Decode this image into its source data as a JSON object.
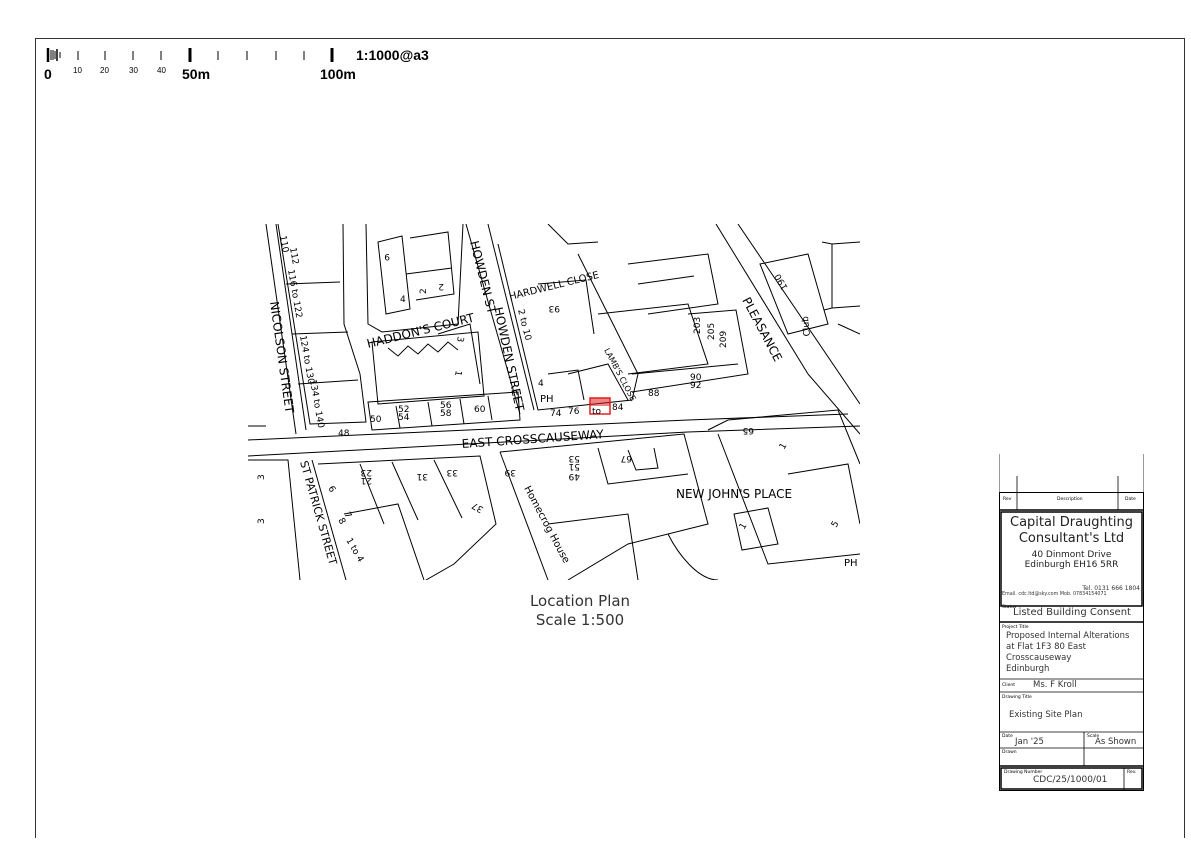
{
  "scale_bar": {
    "ticks": [
      "0",
      "10",
      "20",
      "30",
      "40",
      "50m",
      "100m"
    ],
    "ratio": "1:1000@a3"
  },
  "map": {
    "streets": {
      "nicolson": "NICOLSON STREET",
      "howden_upper": "HOWDEN ST",
      "howden_lower": "HOWDEN STREET",
      "haddons": "HADDON'S COURT",
      "east_cross": "EAST CROSSCAUSEWAY",
      "new_johns": "NEW JOHN'S PLACE",
      "st_patrick": "ST PATRICK STREET",
      "pleasance": "PLEASANCE",
      "hardwell": "HARDWELL CLOSE",
      "lambs": "LAMB'S CLOSE"
    },
    "labels": {
      "n110": "110",
      "n112": "112",
      "n116": "116 to 122",
      "n124": "124 to 130",
      "n134": "134 to 140",
      "n48": "48",
      "n50": "50",
      "n52": "52",
      "n54": "54",
      "n56": "56",
      "n58": "58",
      "n60": "60",
      "n9": "9",
      "n4a": "4",
      "n2": "2",
      "n2b": "2",
      "n3": "3",
      "n1": "1",
      "n2to10": "2 to 10",
      "n4": "4",
      "ph1": "PH",
      "n74": "74",
      "n76": "76",
      "to": "to",
      "n84": "84",
      "n88": "88",
      "n90": "90",
      "n92": "92",
      "n93": "93",
      "n203": "203",
      "n205": "205",
      "n209": "209",
      "n190": "190",
      "club": "Club",
      "n65": "65",
      "n1c": "1",
      "n23": "23",
      "n21": "21",
      "n31": "31",
      "n33": "33",
      "n37": "37",
      "n6": "6",
      "n7": "7",
      "n8": "8",
      "n1to4": "1 to 4",
      "n39": "39",
      "n53": "53",
      "n51": "51",
      "n49": "49",
      "n67": "67",
      "homecrog": "Homecrog House",
      "ph2": "PH",
      "n5": "5",
      "n1d": "1",
      "n3a": "3",
      "n3b": "3"
    }
  },
  "caption": {
    "line1": "Location Plan",
    "line2": "Scale 1:500"
  },
  "title_block": {
    "rev_header": "Rev",
    "desc_header": "Description",
    "date_header": "Date",
    "company_line1": "Capital Draughting",
    "company_line2": "Consultant's Ltd",
    "address1": "40 Dinmont Drive",
    "address2": "Edinburgh EH16 5RR",
    "tel": "Tel. 0131 666 1804",
    "email_mob": "Email. cdc.ltd@sky.com  Mob. 07834154071",
    "status_label": "Status",
    "status": "Listed Building Consent",
    "project_label": "Project Title",
    "project_lines": [
      "Proposed Internal Alterations",
      "at Flat 1F3 80 East",
      "Crosscauseway",
      "Edinburgh"
    ],
    "client_label": "Client",
    "client": "Ms. F Kroll",
    "drawing_title_label": "Drawing Title",
    "drawing_title": "Existing Site Plan",
    "date_label": "Date",
    "date": "Jan '25",
    "scale_label": "Scale",
    "scale": "As Shown",
    "drawn_label": "Drawn",
    "drawing_number_label": "Drawing Number",
    "drawing_number": "CDC/25/1000/01",
    "rev_label": "Rev."
  },
  "colors": {
    "site_outline": "#e02020",
    "linework": "#000000"
  }
}
